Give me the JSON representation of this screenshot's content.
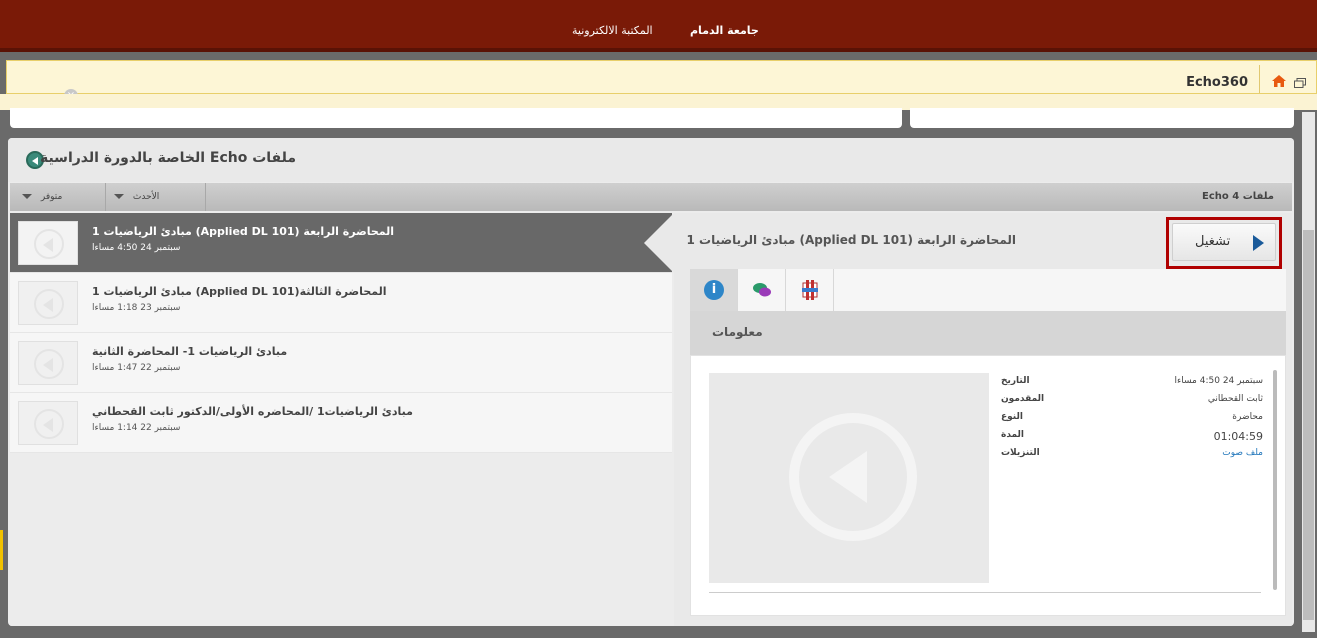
{
  "topnav": {
    "university": "جامعة الدمام",
    "library": "المكتبة الالكترونية"
  },
  "breadcrumb": {
    "label": "Echo360",
    "close": "×",
    "home_icon": "home-icon",
    "window_icon": "window-icon"
  },
  "panel": {
    "title": "الخاصة بالدورة الدراسية Echo ملفات",
    "count_label": "Echo 4 ملفات",
    "filters": {
      "available": "متوفر",
      "latest": "الأحدث"
    }
  },
  "list": [
    {
      "title": "المحاضرة الرابعة (Applied DL 101) مبادئ الرياضيات 1",
      "date": "سبتمبر 24 4:50 مساءا",
      "selected": true
    },
    {
      "title": "المحاضرة الثالثة(Applied DL 101) مبادئ الرياضيات 1",
      "date": "سبتمبر 23 1:18 مساءا",
      "selected": false
    },
    {
      "title": "مبادئ الرياضيات 1- المحاضرة الثانية",
      "date": "سبتمبر 22 1:47 مساءا",
      "selected": false
    },
    {
      "title": "مبادئ الرياضيات1 /المحاضره الأولى/الدكتور ثابت القحطاني",
      "date": "سبتمبر 22 1:14 مساءا",
      "selected": false
    }
  ],
  "detail": {
    "title": "المحاضرة الرابعة (Applied DL 101) مبادئ الرياضيات 1",
    "play_label": "تشغيل",
    "section": "معلومات",
    "tabs": [
      {
        "icon": "info-icon"
      },
      {
        "icon": "discussion-icon"
      },
      {
        "icon": "slides-icon"
      }
    ],
    "meta": {
      "date_label": "التاريخ",
      "date_value": "سبتمبر 24 4:50 مساءا",
      "presenter_label": "المقدمون",
      "presenter_value": "ثابت القحطاني",
      "type_label": "النوع",
      "type_value": "محاضرة",
      "duration_label": "المدة",
      "duration_value": "01:04:59",
      "downloads_label": "التنزيلات",
      "downloads_value": "ملف صوت"
    }
  },
  "colors": {
    "topbar": "#7a1a07",
    "highlight": "#b00000",
    "accent": "#1a5a9a"
  }
}
